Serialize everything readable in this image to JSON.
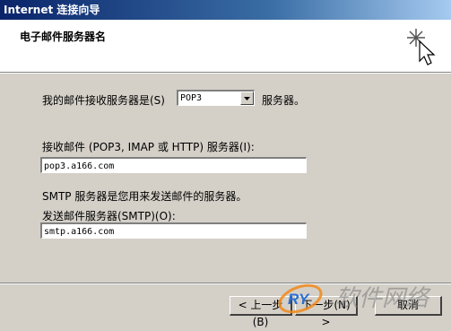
{
  "window": {
    "title": "Internet 连接向导"
  },
  "header": {
    "title": "电子邮件服务器名"
  },
  "incoming_type": {
    "label": "我的邮件接收服务器是(S)",
    "selected": "POP3",
    "suffix": "服务器。"
  },
  "incoming_server": {
    "label": "接收邮件 (POP3, IMAP 或 HTTP) 服务器(I):",
    "value": "pop3.a166.com"
  },
  "smtp_note": "SMTP 服务器是您用来发送邮件的服务器。",
  "outgoing_server": {
    "label": "发送邮件服务器(SMTP)(O):",
    "value": "smtp.a166.com"
  },
  "buttons": {
    "back": "< 上一步(B)",
    "next": "下一步(N) >",
    "cancel": "取消"
  },
  "watermark": {
    "text": "RY",
    "tail": "软件网络"
  },
  "colors": {
    "title_bar": "#0a246a",
    "dialog_bg": "#d4d0c8",
    "watermark_blue": "#2a6fd6",
    "watermark_orange": "#f08a1c"
  }
}
